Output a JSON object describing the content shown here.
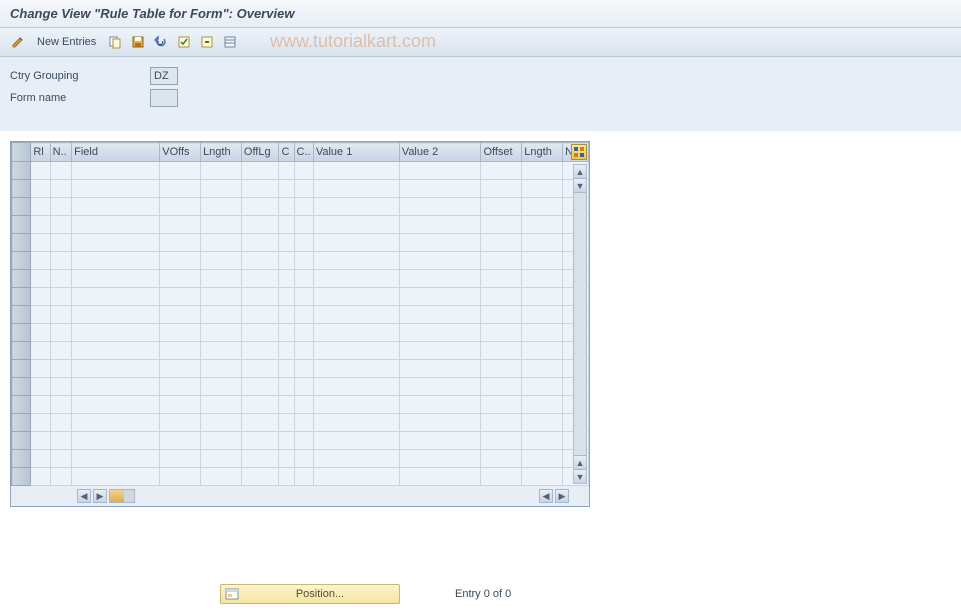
{
  "title": "Change View \"Rule Table for Form\": Overview",
  "toolbar": {
    "new_entries": "New Entries"
  },
  "watermark": "www.tutorialkart.com",
  "form": {
    "ctry_grouping_label": "Ctry Grouping",
    "ctry_grouping_value": "DZ",
    "form_name_label": "Form name",
    "form_name_value": ""
  },
  "columns": {
    "rl": "Rl",
    "n": "N..",
    "field": "Field",
    "voffs": "VOffs",
    "lngth": "Lngth",
    "offlg": "OffLg",
    "c1": "C",
    "c2": "C..",
    "val1": "Value 1",
    "val2": "Value 2",
    "offset": "Offset",
    "lngth2": "Lngth",
    "new": "Ne"
  },
  "rows": [
    {},
    {},
    {},
    {},
    {},
    {},
    {},
    {},
    {},
    {},
    {},
    {},
    {},
    {},
    {},
    {},
    {},
    {}
  ],
  "footer": {
    "position_label": "Position...",
    "entry_text": "Entry 0 of 0"
  }
}
